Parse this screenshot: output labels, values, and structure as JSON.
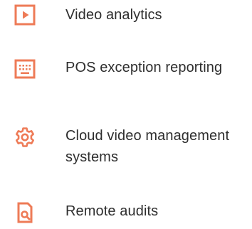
{
  "colors": {
    "accent": "#EE7B57",
    "text": "#2E2E2E",
    "background": "#FFFFFF"
  },
  "features": [
    {
      "icon": "play-icon",
      "label": "Video analytics"
    },
    {
      "icon": "keyboard-icon",
      "label": "POS exception reporting"
    },
    {
      "icon": "gear-icon",
      "label": "Cloud video management systems"
    },
    {
      "icon": "document-search-icon",
      "label": "Remote audits"
    }
  ]
}
